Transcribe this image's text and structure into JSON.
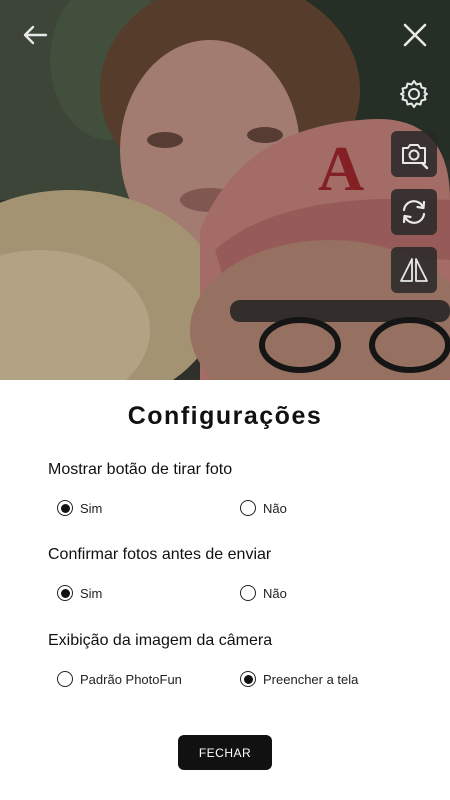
{
  "camera": {
    "back_icon": "arrow-left-icon",
    "close_icon": "close-icon",
    "side_buttons": [
      "gear-icon",
      "camera-search-icon",
      "switch-camera-icon",
      "mirror-icon"
    ]
  },
  "settings": {
    "title": "Configurações",
    "sections": [
      {
        "label": "Mostrar botão de tirar foto",
        "options": [
          {
            "label": "Sim",
            "selected": true
          },
          {
            "label": "Não",
            "selected": false
          }
        ]
      },
      {
        "label": "Confirmar fotos antes de enviar",
        "options": [
          {
            "label": "Sim",
            "selected": true
          },
          {
            "label": "Não",
            "selected": false
          }
        ]
      },
      {
        "label": "Exibição da imagem da câmera",
        "options": [
          {
            "label": "Padrão PhotoFun",
            "selected": false
          },
          {
            "label": "Preencher a tela",
            "selected": true
          }
        ]
      }
    ],
    "close_button_label": "FECHAR"
  }
}
